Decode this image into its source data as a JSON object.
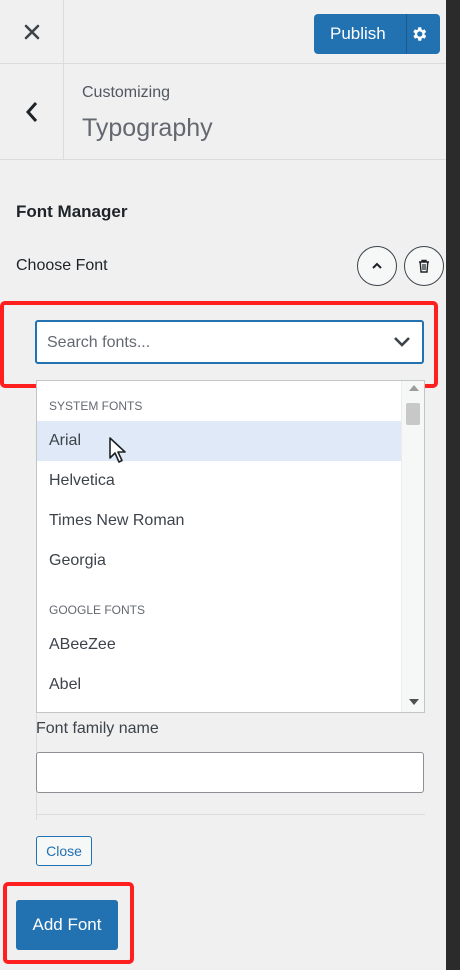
{
  "header": {
    "close_icon": "close-icon",
    "publish_label": "Publish",
    "settings_icon": "gear-icon"
  },
  "section": {
    "back_icon": "chevron-left-icon",
    "breadcrumb": "Customizing",
    "title": "Typography"
  },
  "font_manager": {
    "title": "Font Manager",
    "choose_font_label": "Choose Font",
    "collapse_icon": "chevron-up-icon",
    "delete_icon": "trash-icon",
    "search": {
      "placeholder": "Search fonts...",
      "value": ""
    },
    "dropdown": {
      "groups": [
        {
          "label": "SYSTEM FONTS",
          "items": [
            "Arial",
            "Helvetica",
            "Times New Roman",
            "Georgia"
          ]
        },
        {
          "label": "GOOGLE FONTS",
          "items": [
            "ABeeZee",
            "Abel"
          ]
        }
      ],
      "hovered_item": "Arial"
    },
    "font_family_label": "Font family name",
    "font_family_value": "",
    "close_label": "Close",
    "add_font_label": "Add Font"
  },
  "colors": {
    "accent": "#2271b1",
    "highlight": "#ff1f1f",
    "hover": "#dfe9f7"
  }
}
